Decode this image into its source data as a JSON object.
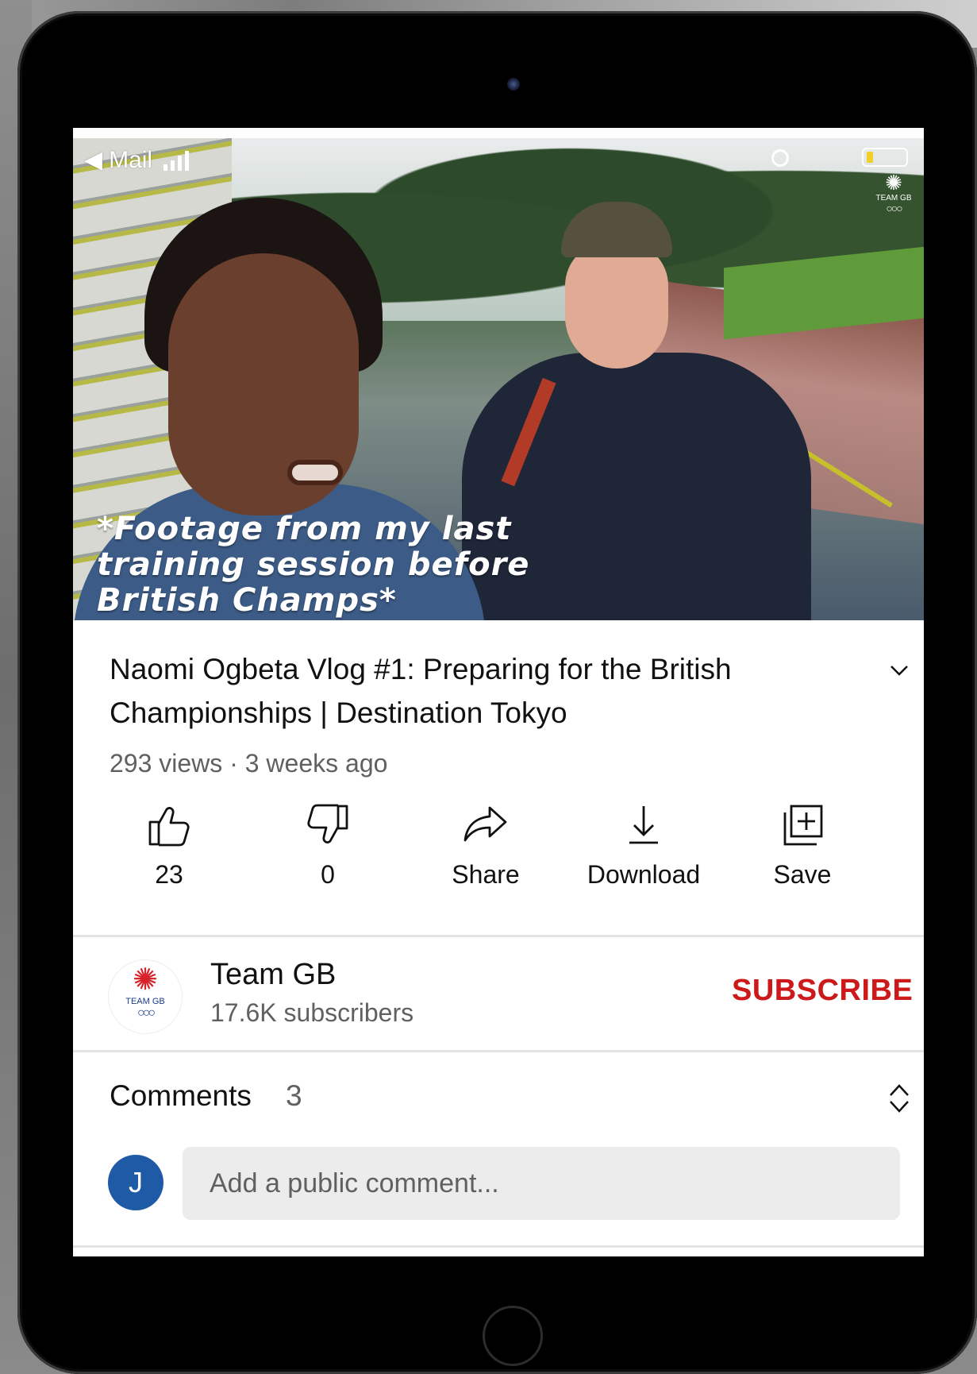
{
  "status_bar": {
    "back_app": "Mail"
  },
  "video": {
    "caption": "*Footage from my last\ntraining session before\nBritish Champs*",
    "logo_text": "TEAM GB",
    "progress": 0.022
  },
  "title": "Naomi Ogbeta Vlog #1: Preparing for the British Championships | Destination Tokyo",
  "meta": {
    "views": "293 views",
    "separator": "·",
    "age": "3 weeks ago"
  },
  "actions": [
    {
      "icon": "thumbs-up-icon",
      "label": "23"
    },
    {
      "icon": "thumbs-down-icon",
      "label": "0"
    },
    {
      "icon": "share-icon",
      "label": "Share"
    },
    {
      "icon": "download-icon",
      "label": "Download"
    },
    {
      "icon": "save-icon",
      "label": "Save"
    }
  ],
  "channel": {
    "name": "Team GB",
    "subscribers": "17.6K subscribers",
    "avatar_text": "TEAM GB",
    "subscribe_label": "SUBSCRIBE"
  },
  "comments": {
    "label": "Comments",
    "count": "3",
    "user_initial": "J",
    "placeholder": "Add a public comment..."
  },
  "colors": {
    "subscribe": "#cc1a1a",
    "avatar": "#1f5aa6",
    "progress": "#e02020"
  }
}
